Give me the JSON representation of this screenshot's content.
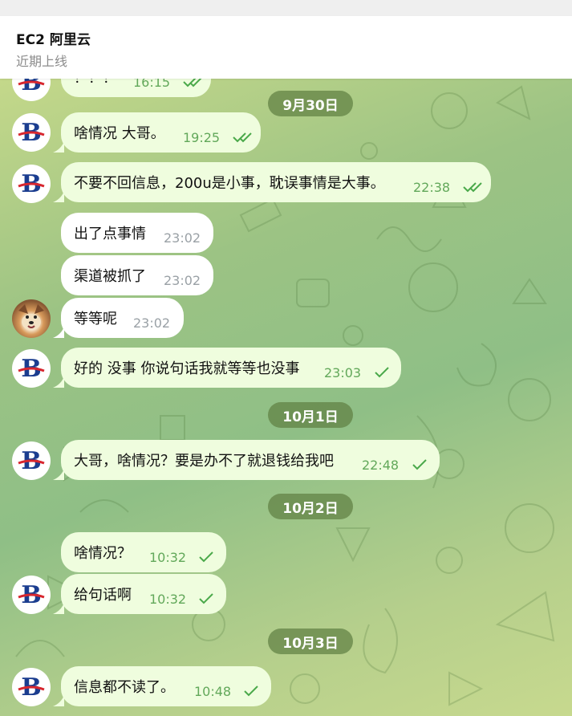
{
  "header": {
    "title": "EC2 阿里云",
    "status": "近期上线"
  },
  "colors": {
    "outgoing_bubble": "#effdde",
    "incoming_bubble": "#ffffff",
    "check_color": "#4aa94a",
    "date_pill": "#6d8a4a"
  },
  "dates": [
    "9月30日",
    "10月1日",
    "10月2日",
    "10月3日"
  ],
  "messages": [
    {
      "text": "？？？",
      "time": "16:15",
      "status": "read",
      "icon": "double-check-icon"
    },
    {
      "text": "啥情况 大哥。",
      "time": "19:25",
      "status": "read",
      "icon": "double-check-icon"
    },
    {
      "text": "不要不回信息，200u是小事，耽误事情是大事。",
      "time": "22:38",
      "status": "read",
      "icon": "double-check-icon"
    },
    {
      "text": "出了点事情",
      "time": "23:02"
    },
    {
      "text": "渠道被抓了",
      "time": "23:02"
    },
    {
      "text": "等等呢",
      "time": "23:02"
    },
    {
      "text": "好的 没事 你说句话我就等等也没事",
      "time": "23:03",
      "status": "sent",
      "icon": "check-icon"
    },
    {
      "text": "大哥，啥情况？要是办不了就退钱给我吧",
      "time": "22:48",
      "status": "sent",
      "icon": "check-icon"
    },
    {
      "text": "啥情况？",
      "time": "10:32",
      "status": "sent",
      "icon": "check-icon"
    },
    {
      "text": "给句话啊",
      "time": "10:32",
      "status": "sent",
      "icon": "check-icon"
    },
    {
      "text": "信息都不读了。",
      "time": "10:48",
      "status": "sent",
      "icon": "check-icon"
    }
  ]
}
